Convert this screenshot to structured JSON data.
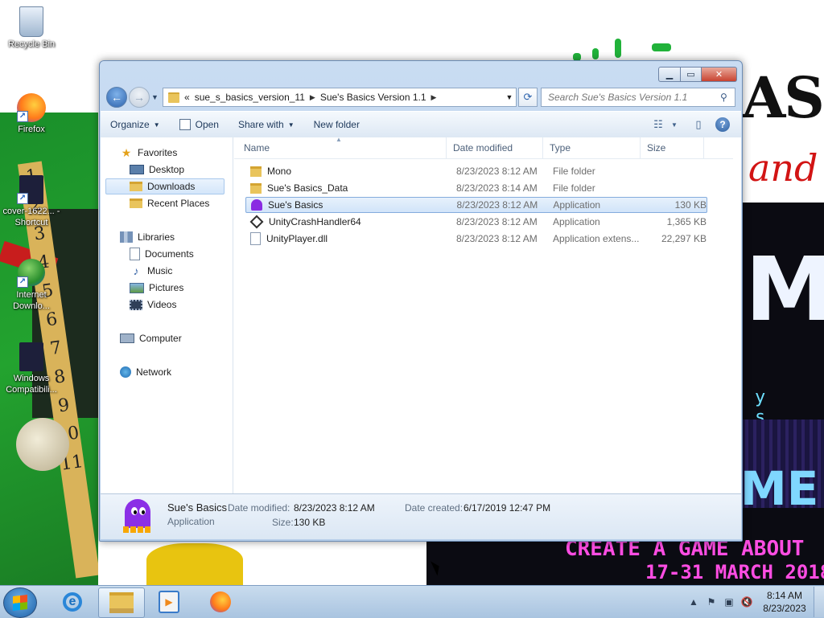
{
  "desktop": {
    "icons": [
      {
        "label": "Recycle Bin"
      },
      {
        "label": "Firefox"
      },
      {
        "label": "cover-1622... - Shortcut"
      },
      {
        "label": "Internet Downlo..."
      },
      {
        "label": "Windows Compatibili..."
      }
    ],
    "wallpaper_text": {
      "right_top": "AS",
      "right_and": "and",
      "right_m": "M",
      "right_ys": "y s t",
      "right_me": "ME",
      "banner_line1": "CREATE A GAME ABOUT",
      "banner_line2": "17-31 MARCH 2018"
    }
  },
  "window": {
    "caption": {
      "min": "▁",
      "max": "▭",
      "close": "✕"
    },
    "address": {
      "overflow": "«",
      "crumbs": [
        "sue_s_basics_version_11",
        "Sue's Basics Version 1.1"
      ]
    },
    "search_placeholder": "Search Sue's Basics Version 1.1",
    "toolbar": {
      "organize": "Organize",
      "open": "Open",
      "share_with": "Share with",
      "new_folder": "New folder"
    },
    "nav": {
      "favorites": "Favorites",
      "desktop": "Desktop",
      "downloads": "Downloads",
      "recent_places": "Recent Places",
      "libraries": "Libraries",
      "documents": "Documents",
      "music": "Music",
      "pictures": "Pictures",
      "videos": "Videos",
      "computer": "Computer",
      "network": "Network"
    },
    "columns": {
      "name": "Name",
      "date": "Date modified",
      "type": "Type",
      "size": "Size"
    },
    "files": [
      {
        "name": "Mono",
        "date": "8/23/2023 8:12 AM",
        "type": "File folder",
        "size": ""
      },
      {
        "name": "Sue's Basics_Data",
        "date": "8/23/2023 8:14 AM",
        "type": "File folder",
        "size": ""
      },
      {
        "name": "Sue's Basics",
        "date": "8/23/2023 8:12 AM",
        "type": "Application",
        "size": "130 KB"
      },
      {
        "name": "UnityCrashHandler64",
        "date": "8/23/2023 8:12 AM",
        "type": "Application",
        "size": "1,365 KB"
      },
      {
        "name": "UnityPlayer.dll",
        "date": "8/23/2023 8:12 AM",
        "type": "Application extens...",
        "size": "22,297 KB"
      }
    ],
    "details": {
      "name": "Sue's Basics",
      "type": "Application",
      "date_modified_label": "Date modified:",
      "date_modified": "8/23/2023 8:12 AM",
      "size_label": "Size:",
      "size": "130 KB",
      "date_created_label": "Date created:",
      "date_created": "6/17/2019 12:47 PM"
    }
  },
  "taskbar": {
    "clock_time": "8:14 AM",
    "clock_date": "8/23/2023"
  }
}
